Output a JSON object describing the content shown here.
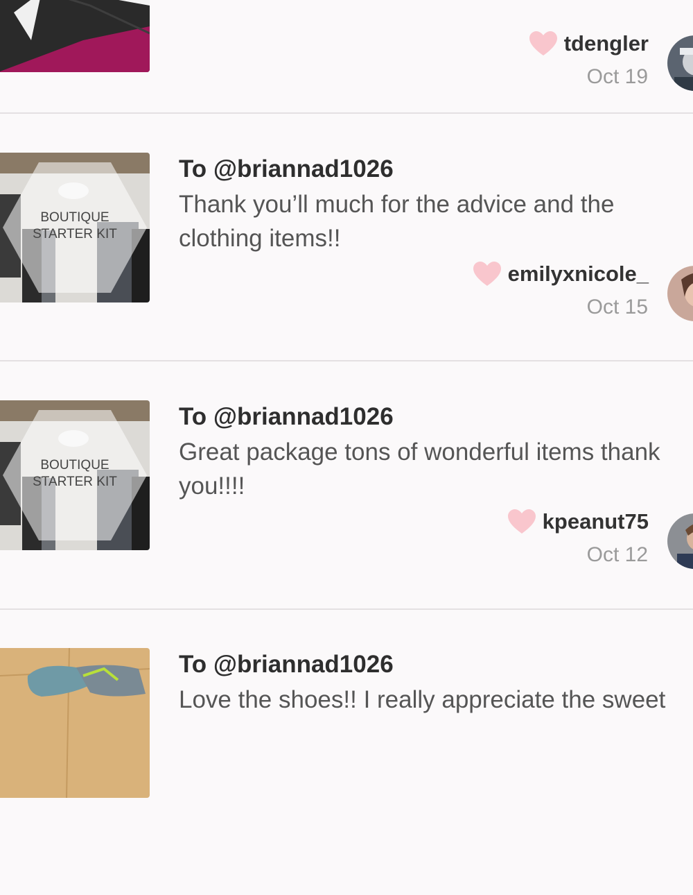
{
  "feed": {
    "entries": [
      {
        "to": "",
        "message_lines": [],
        "username": "tdengler",
        "date": "Oct 19",
        "thumb": "black-bag-photo",
        "avatar": "user-avatar-tdengler"
      },
      {
        "to": "To @briannad1026",
        "message_lines": [
          "Thank you’ll much for the advice and the",
          "clothing items!!"
        ],
        "username": "emilyxnicole_",
        "date": "Oct 15",
        "thumb": "boutique-starter-kit-photo",
        "thumb_text_lines": [
          "BOUTIQUE",
          "STARTER KIT"
        ],
        "avatar": "user-avatar-emilyxnicole"
      },
      {
        "to": "To @briannad1026",
        "message_lines": [
          "Great package tons of wonderful items thank",
          "you!!!!"
        ],
        "username": "kpeanut75",
        "date": "Oct 12",
        "thumb": "boutique-starter-kit-photo",
        "thumb_text_lines": [
          "BOUTIQUE",
          "STARTER KIT"
        ],
        "avatar": "user-avatar-kpeanut75"
      },
      {
        "to": "To @briannad1026",
        "message_lines": [
          "Love the shoes!! I really appreciate the sweet"
        ],
        "thumb": "sneakers-photo"
      }
    ]
  },
  "colors": {
    "background": "#fbf9fa",
    "heart": "#f9c6cd",
    "divider": "#e4e0e2",
    "username": "#333333",
    "date": "#9a9a9a"
  },
  "icons": [
    "heart-icon"
  ]
}
